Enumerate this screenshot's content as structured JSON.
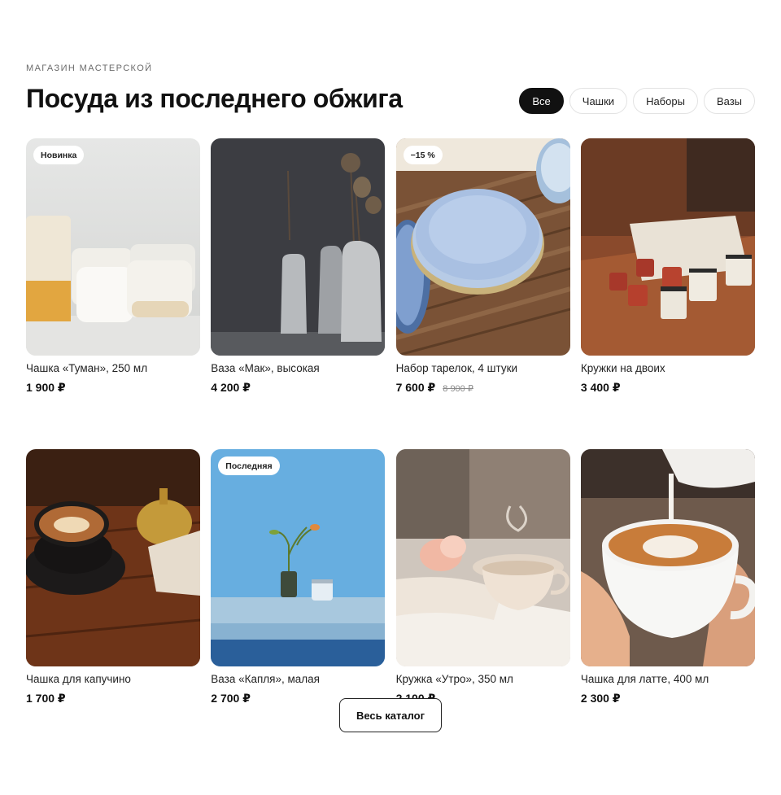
{
  "header": {
    "eyebrow": "МАГАЗИН МАСТЕРСКОЙ",
    "title": "Посуда из последнего обжига"
  },
  "filters": [
    {
      "label": "Все",
      "active": true
    },
    {
      "label": "Чашки",
      "active": false
    },
    {
      "label": "Наборы",
      "active": false
    },
    {
      "label": "Вазы",
      "active": false
    }
  ],
  "products": [
    {
      "name": "Чашка «Туман», 250 мл",
      "price": "1 900 ₽",
      "old_price": "",
      "badge": "Новинка",
      "image": "cups-cream-photo"
    },
    {
      "name": "Ваза «Мак», высокая",
      "price": "4 200 ₽",
      "old_price": "",
      "badge": "",
      "image": "vases-dark-photo"
    },
    {
      "name": "Набор тарелок, 4 штуки",
      "price": "7 600 ₽",
      "old_price": "8 900 ₽",
      "badge": "−15 %",
      "image": "blue-plates-photo"
    },
    {
      "name": "Кружки на двоих",
      "price": "3 400 ₽",
      "old_price": "",
      "badge": "",
      "image": "enamel-mugs-photo"
    },
    {
      "name": "Чашка для капучино",
      "price": "1 700 ₽",
      "old_price": "",
      "badge": "",
      "image": "cappuccino-photo"
    },
    {
      "name": "Ваза «Капля», малая",
      "price": "2 700 ₽",
      "old_price": "",
      "badge": "Последняя",
      "image": "small-vase-blue-photo"
    },
    {
      "name": "Кружка «Утро», 350 мл",
      "price": "2 100 ₽",
      "old_price": "",
      "badge": "",
      "image": "morning-cup-photo"
    },
    {
      "name": "Чашка для латте, 400 мл",
      "price": "2 300 ₽",
      "old_price": "",
      "badge": "",
      "image": "latte-pour-photo"
    }
  ],
  "catalog_button": "Весь каталог"
}
